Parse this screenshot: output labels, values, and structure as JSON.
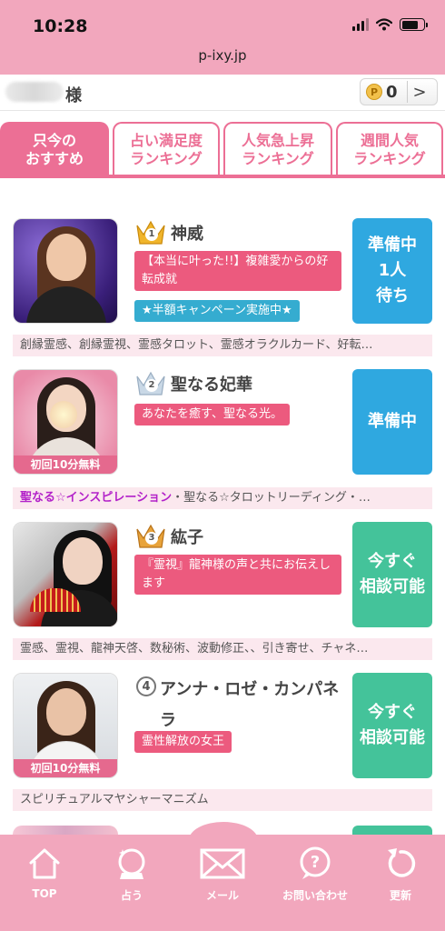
{
  "status_bar": {
    "time": "10:28"
  },
  "browser": {
    "url": "p-ixy.jp"
  },
  "user": {
    "name_suffix": "様",
    "points": "0",
    "coin_symbol": "P"
  },
  "tabs": [
    {
      "label": "只今の\nおすすめ",
      "active": true
    },
    {
      "label": "占い満足度\nランキング",
      "active": false
    },
    {
      "label": "人気急上昇\nランキング",
      "active": false
    },
    {
      "label": "週間人気\nランキング",
      "active": false
    }
  ],
  "fortune_tellers": [
    {
      "rank": "1",
      "name": "神威",
      "tags": [
        "【本当に叶った!!】複雑愛からの好転成就",
        "★半額キャンペーン実施中★"
      ],
      "status": "準備中\n1人\n待ち",
      "status_color": "#2fa8e0",
      "free_badge": "",
      "genres_accent": "",
      "genres": "創縁霊感、創縁霊視、霊感タロット、霊感オラクルカード、好転…"
    },
    {
      "rank": "2",
      "name": "聖なる妃華",
      "tags": [
        "あなたを癒す、聖なる光。"
      ],
      "status": "準備中",
      "status_color": "#2fa8e0",
      "free_badge": "初回10分無料",
      "genres_accent": "聖なる☆インスピレーション",
      "genres": "・聖なる☆タロットリーディング・…"
    },
    {
      "rank": "3",
      "name": "紘子",
      "tags": [
        "『霊視』龍神様の声と共にお伝えします"
      ],
      "status": "今すぐ\n相談可能",
      "status_color": "#44c39a",
      "free_badge": "",
      "genres_accent": "",
      "genres": "霊感、霊視、龍神天啓、数秘術、波動修正、、引き寄せ、チャネ…"
    },
    {
      "rank": "4",
      "name": "アンナ・ロゼ・カンパネラ",
      "tags": [
        "霊性解放の女王"
      ],
      "status": "今すぐ\n相談可能",
      "status_color": "#44c39a",
      "free_badge": "初回10分無料",
      "genres_accent": "",
      "genres": "スピリチュアルマヤシャーマニズム"
    }
  ],
  "bottom_nav": [
    {
      "label": "TOP",
      "icon": "home-icon"
    },
    {
      "label": "占う",
      "icon": "crystal-ball-icon"
    },
    {
      "label": "メール",
      "icon": "mail-icon"
    },
    {
      "label": "お問い合わせ",
      "icon": "question-bubble-icon"
    },
    {
      "label": "更新",
      "icon": "refresh-icon"
    }
  ]
}
